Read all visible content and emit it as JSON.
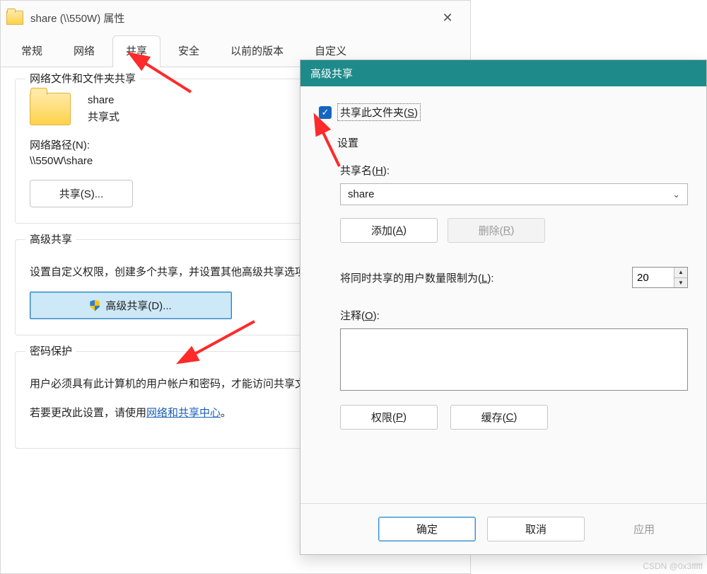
{
  "props": {
    "title": "share (\\\\550W) 属性",
    "tabs": [
      "常规",
      "网络",
      "共享",
      "安全",
      "以前的版本",
      "自定义"
    ],
    "active_tab_index": 2,
    "section_network_share": {
      "title": "网络文件和文件夹共享",
      "item_name": "share",
      "item_status": "共享式",
      "path_label": "网络路径(N):",
      "path_value": "\\\\550W\\share",
      "share_button": "共享(S)..."
    },
    "section_advanced": {
      "title": "高级共享",
      "description": "设置自定义权限，创建多个共享，并设置其他高级共享选项。",
      "button": "高级共享(D)..."
    },
    "section_password": {
      "title": "密码保护",
      "line1": "用户必须具有此计算机的用户帐户和密码，才能访问共享文件夹。",
      "line2_prefix": "若要更改此设置，请使用",
      "line2_link": "网络和共享中心",
      "line2_suffix": "。"
    }
  },
  "adv": {
    "title": "高级共享",
    "checkbox_label_pre": "共享此文件夹(",
    "checkbox_hotkey": "S",
    "checkbox_label_post": ")",
    "checkbox_checked": true,
    "settings_label": "设置",
    "share_name_label_pre": "共享名(",
    "share_name_hotkey": "H",
    "share_name_label_post": "):",
    "share_name_value": "share",
    "add_btn_pre": "添加(",
    "add_btn_hotkey": "A",
    "add_btn_post": ")",
    "remove_btn_pre": "删除(",
    "remove_btn_hotkey": "R",
    "remove_btn_post": ")",
    "limit_label_pre": "将同时共享的用户数量限制为(",
    "limit_hotkey": "L",
    "limit_label_post": "):",
    "limit_value": "20",
    "comment_label_pre": "注释(",
    "comment_hotkey": "O",
    "comment_label_post": "):",
    "perm_btn_pre": "权限(",
    "perm_btn_hotkey": "P",
    "perm_btn_post": ")",
    "cache_btn_pre": "缓存(",
    "cache_btn_hotkey": "C",
    "cache_btn_post": ")",
    "ok": "确定",
    "cancel": "取消",
    "apply": "应用"
  },
  "watermark": "CSDN @0x3fffff"
}
